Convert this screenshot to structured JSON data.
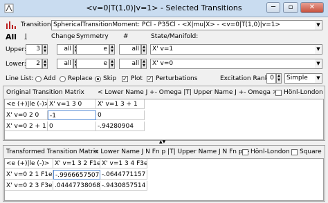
{
  "window": {
    "title": "<v=0|T(1,0)|v=1> - Selected Transitions"
  },
  "toolbar": {
    "transition_label": "Transition",
    "transition_value": "SphericalTransitionMoment: PCl - P35Cl - <X|mu|X> - <v=0|T(1,0)|v=1>"
  },
  "headers": {
    "all": "All",
    "j": "J",
    "change": "Change",
    "symmetry": "Symmetry",
    "hash": "#",
    "state_manifold": "State/Manifold:"
  },
  "upper": {
    "label": "Upper:",
    "j": "3",
    "change": "all",
    "symmetry": "e",
    "number": "all",
    "state": "X' v=1"
  },
  "lower": {
    "label": "Lower:",
    "j": "2",
    "change": "all",
    "symmetry": "e",
    "number": "all",
    "state": "X' v=0"
  },
  "line_list": {
    "label": "Line List:",
    "add": "Add",
    "replace": "Replace",
    "skip": "Skip",
    "selected": "skip",
    "plot": "Plot",
    "plot_checked": true,
    "perturbations": "Perturbations",
    "perturbations_checked": true,
    "excitation_rank_label": "Excitation Rank:",
    "excitation_rank": "0",
    "mode": "Simple"
  },
  "original": {
    "title": "Original Transition Matrix",
    "header_right": "< Lower Name  J +- Omega |T| Upper Name  J +- Omega >",
    "honl": "Hönl-London",
    "corner": "<e (+)|le (-)>",
    "col_headers": [
      "X' v=1   3   0",
      "X' v=1   3 + 1"
    ],
    "rows": [
      {
        "label": "X' v=0  2   0",
        "cells": [
          "-1",
          "0"
        ]
      },
      {
        "label": "X' v=0  2 + 1",
        "cells": [
          "0",
          "-.94280904"
        ]
      }
    ]
  },
  "transformed": {
    "title": "Transformed Transition Matrix",
    "header_right": "< Lower Name  J  N Fn p |T| Upper Name  J  N Fn p >",
    "honl": "Hönl-London",
    "square": "Square",
    "corner": "<e (+)|le (-)>",
    "col_headers": [
      "X' v=1   3   2 F1e",
      "X' v=1   3   4 F3e"
    ],
    "rows": [
      {
        "label": "X' v=0  2   1 F1e",
        "cells": [
          "-.9966657507",
          "-.0644771157"
        ]
      },
      {
        "label": "X' v=0  2   3 F3e",
        "cells": [
          ".04447738068",
          "-.9430857514"
        ]
      }
    ]
  }
}
